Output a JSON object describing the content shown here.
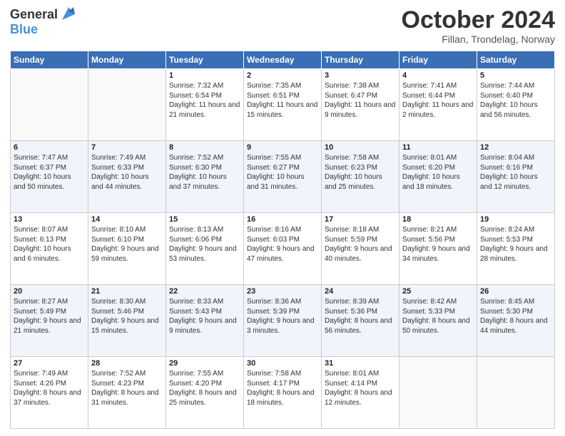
{
  "header": {
    "logo_line1": "General",
    "logo_line2": "Blue",
    "title": "October 2024",
    "location": "Fillan, Trondelag, Norway"
  },
  "weekdays": [
    "Sunday",
    "Monday",
    "Tuesday",
    "Wednesday",
    "Thursday",
    "Friday",
    "Saturday"
  ],
  "weeks": [
    [
      null,
      null,
      {
        "day": 1,
        "sunrise": "7:32 AM",
        "sunset": "6:54 PM",
        "daylight": "11 hours and 21 minutes."
      },
      {
        "day": 2,
        "sunrise": "7:35 AM",
        "sunset": "6:51 PM",
        "daylight": "11 hours and 15 minutes."
      },
      {
        "day": 3,
        "sunrise": "7:38 AM",
        "sunset": "6:47 PM",
        "daylight": "11 hours and 9 minutes."
      },
      {
        "day": 4,
        "sunrise": "7:41 AM",
        "sunset": "6:44 PM",
        "daylight": "11 hours and 2 minutes."
      },
      {
        "day": 5,
        "sunrise": "7:44 AM",
        "sunset": "6:40 PM",
        "daylight": "10 hours and 56 minutes."
      }
    ],
    [
      {
        "day": 6,
        "sunrise": "7:47 AM",
        "sunset": "6:37 PM",
        "daylight": "10 hours and 50 minutes."
      },
      {
        "day": 7,
        "sunrise": "7:49 AM",
        "sunset": "6:33 PM",
        "daylight": "10 hours and 44 minutes."
      },
      {
        "day": 8,
        "sunrise": "7:52 AM",
        "sunset": "6:30 PM",
        "daylight": "10 hours and 37 minutes."
      },
      {
        "day": 9,
        "sunrise": "7:55 AM",
        "sunset": "6:27 PM",
        "daylight": "10 hours and 31 minutes."
      },
      {
        "day": 10,
        "sunrise": "7:58 AM",
        "sunset": "6:23 PM",
        "daylight": "10 hours and 25 minutes."
      },
      {
        "day": 11,
        "sunrise": "8:01 AM",
        "sunset": "6:20 PM",
        "daylight": "10 hours and 18 minutes."
      },
      {
        "day": 12,
        "sunrise": "8:04 AM",
        "sunset": "6:16 PM",
        "daylight": "10 hours and 12 minutes."
      }
    ],
    [
      {
        "day": 13,
        "sunrise": "8:07 AM",
        "sunset": "6:13 PM",
        "daylight": "10 hours and 6 minutes."
      },
      {
        "day": 14,
        "sunrise": "8:10 AM",
        "sunset": "6:10 PM",
        "daylight": "9 hours and 59 minutes."
      },
      {
        "day": 15,
        "sunrise": "8:13 AM",
        "sunset": "6:06 PM",
        "daylight": "9 hours and 53 minutes."
      },
      {
        "day": 16,
        "sunrise": "8:16 AM",
        "sunset": "6:03 PM",
        "daylight": "9 hours and 47 minutes."
      },
      {
        "day": 17,
        "sunrise": "8:18 AM",
        "sunset": "5:59 PM",
        "daylight": "9 hours and 40 minutes."
      },
      {
        "day": 18,
        "sunrise": "8:21 AM",
        "sunset": "5:56 PM",
        "daylight": "9 hours and 34 minutes."
      },
      {
        "day": 19,
        "sunrise": "8:24 AM",
        "sunset": "5:53 PM",
        "daylight": "9 hours and 28 minutes."
      }
    ],
    [
      {
        "day": 20,
        "sunrise": "8:27 AM",
        "sunset": "5:49 PM",
        "daylight": "9 hours and 21 minutes."
      },
      {
        "day": 21,
        "sunrise": "8:30 AM",
        "sunset": "5:46 PM",
        "daylight": "9 hours and 15 minutes."
      },
      {
        "day": 22,
        "sunrise": "8:33 AM",
        "sunset": "5:43 PM",
        "daylight": "9 hours and 9 minutes."
      },
      {
        "day": 23,
        "sunrise": "8:36 AM",
        "sunset": "5:39 PM",
        "daylight": "9 hours and 3 minutes."
      },
      {
        "day": 24,
        "sunrise": "8:39 AM",
        "sunset": "5:36 PM",
        "daylight": "8 hours and 56 minutes."
      },
      {
        "day": 25,
        "sunrise": "8:42 AM",
        "sunset": "5:33 PM",
        "daylight": "8 hours and 50 minutes."
      },
      {
        "day": 26,
        "sunrise": "8:45 AM",
        "sunset": "5:30 PM",
        "daylight": "8 hours and 44 minutes."
      }
    ],
    [
      {
        "day": 27,
        "sunrise": "7:49 AM",
        "sunset": "4:26 PM",
        "daylight": "8 hours and 37 minutes."
      },
      {
        "day": 28,
        "sunrise": "7:52 AM",
        "sunset": "4:23 PM",
        "daylight": "8 hours and 31 minutes."
      },
      {
        "day": 29,
        "sunrise": "7:55 AM",
        "sunset": "4:20 PM",
        "daylight": "8 hours and 25 minutes."
      },
      {
        "day": 30,
        "sunrise": "7:58 AM",
        "sunset": "4:17 PM",
        "daylight": "8 hours and 18 minutes."
      },
      {
        "day": 31,
        "sunrise": "8:01 AM",
        "sunset": "4:14 PM",
        "daylight": "8 hours and 12 minutes."
      },
      null,
      null
    ]
  ]
}
